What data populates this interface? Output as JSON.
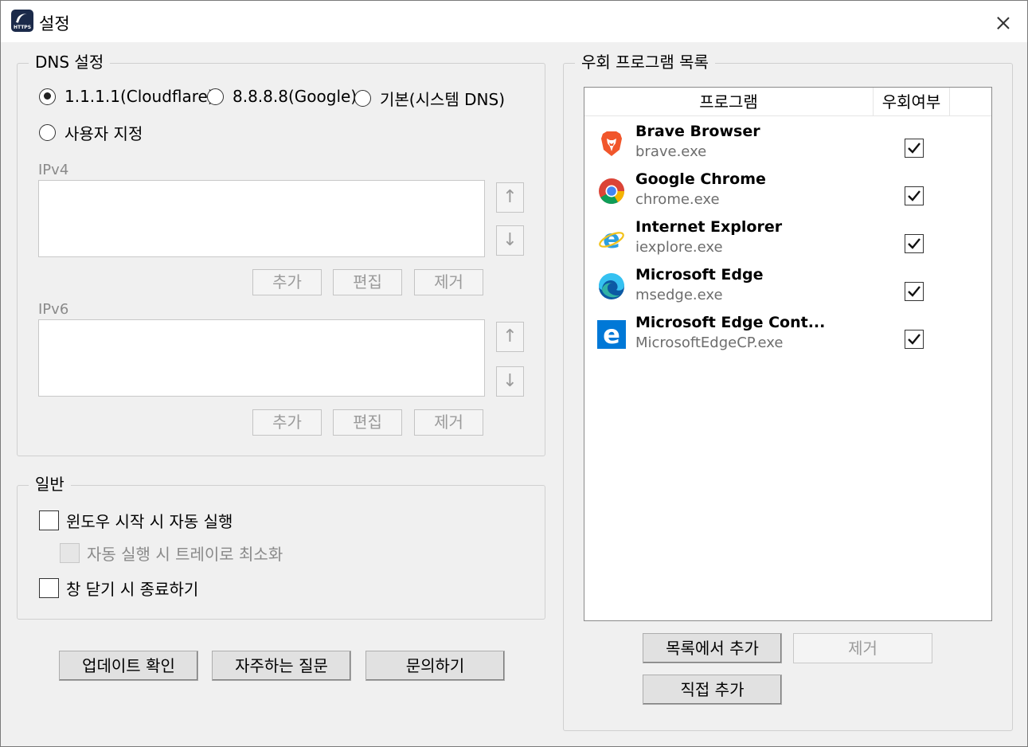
{
  "window": {
    "title": "설정",
    "app_icon_text": "HTTPS"
  },
  "dns": {
    "group_title": "DNS 설정",
    "options": [
      {
        "label": "1.1.1.1(Cloudflare)",
        "selected": true
      },
      {
        "label": "8.8.8.8(Google)",
        "selected": false
      },
      {
        "label": "기본(시스템 DNS)",
        "selected": false
      },
      {
        "label": "사용자 지정",
        "selected": false
      }
    ],
    "ipv4_label": "IPv4",
    "ipv6_label": "IPv6",
    "up_arrow": "↑",
    "down_arrow": "↓",
    "add_label": "추가",
    "edit_label": "편집",
    "remove_label": "제거"
  },
  "general": {
    "group_title": "일반",
    "autostart_label": "윈도우 시작 시 자동 실행",
    "minimize_label": "자동 실행 시 트레이로 최소화",
    "exit_on_close_label": "창 닫기 시 종료하기"
  },
  "footer": {
    "update_label": "업데이트 확인",
    "faq_label": "자주하는 질문",
    "contact_label": "문의하기"
  },
  "bypass": {
    "group_title": "우회 프로그램 목록",
    "col_program": "프로그램",
    "col_bypass": "우회여부",
    "programs": [
      {
        "name": "Brave Browser",
        "exe": "brave.exe",
        "checked": true,
        "icon": "brave-icon"
      },
      {
        "name": "Google Chrome",
        "exe": "chrome.exe",
        "checked": true,
        "icon": "chrome-icon"
      },
      {
        "name": "Internet Explorer",
        "exe": "iexplore.exe",
        "checked": true,
        "icon": "ie-icon"
      },
      {
        "name": "Microsoft Edge",
        "exe": "msedge.exe",
        "checked": true,
        "icon": "edge-icon"
      },
      {
        "name": "Microsoft Edge Cont...",
        "exe": "MicrosoftEdgeCP.exe",
        "checked": true,
        "icon": "edge-legacy-icon"
      }
    ],
    "add_from_list_label": "목록에서 추가",
    "remove_label": "제거",
    "add_direct_label": "직접 추가"
  }
}
